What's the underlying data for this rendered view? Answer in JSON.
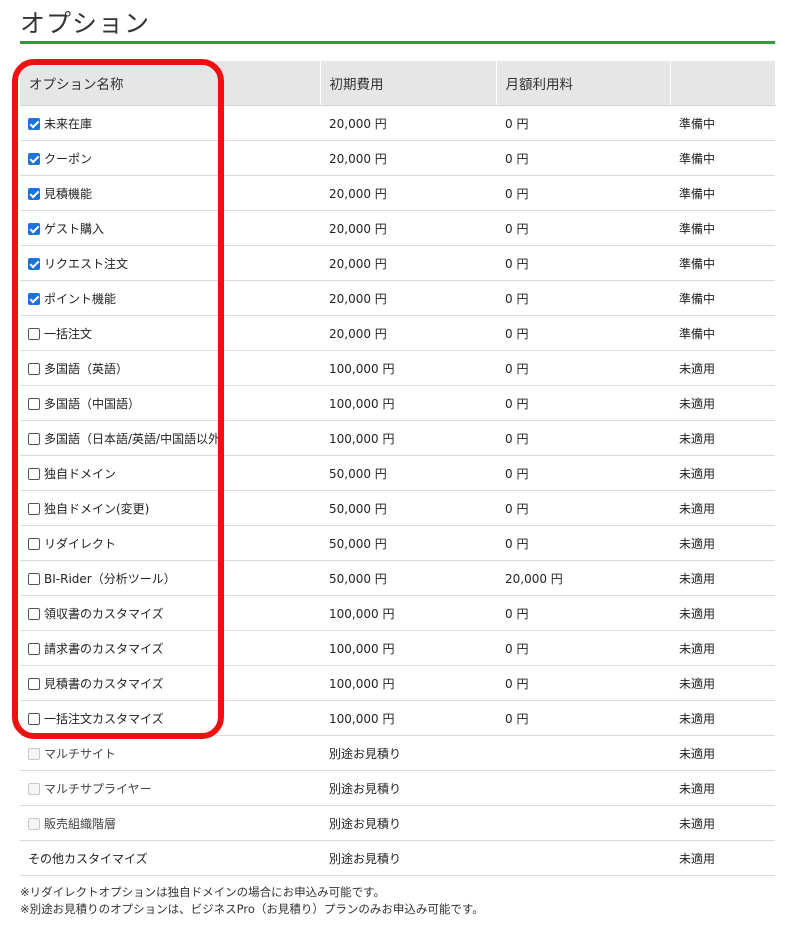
{
  "page": {
    "title": "オプション"
  },
  "colors": {
    "accent_rule": "#2e9a3c",
    "checkbox_checked": "#1a73d9",
    "highlight": "#ee1111"
  },
  "table": {
    "headers": [
      "オプション名称",
      "初期費用",
      "月額利用料",
      ""
    ],
    "rows": [
      {
        "name": "未来在庫",
        "initial": "20,000 円",
        "monthly": "0 円",
        "status": "準備中",
        "checkbox": "checked"
      },
      {
        "name": "クーポン",
        "initial": "20,000 円",
        "monthly": "0 円",
        "status": "準備中",
        "checkbox": "checked"
      },
      {
        "name": "見積機能",
        "initial": "20,000 円",
        "monthly": "0 円",
        "status": "準備中",
        "checkbox": "checked"
      },
      {
        "name": "ゲスト購入",
        "initial": "20,000 円",
        "monthly": "0 円",
        "status": "準備中",
        "checkbox": "checked"
      },
      {
        "name": "リクエスト注文",
        "initial": "20,000 円",
        "monthly": "0 円",
        "status": "準備中",
        "checkbox": "checked"
      },
      {
        "name": "ポイント機能",
        "initial": "20,000 円",
        "monthly": "0 円",
        "status": "準備中",
        "checkbox": "checked"
      },
      {
        "name": "一括注文",
        "initial": "20,000 円",
        "monthly": "0 円",
        "status": "準備中",
        "checkbox": "unchecked"
      },
      {
        "name": "多国語（英語）",
        "initial": "100,000 円",
        "monthly": "0 円",
        "status": "未適用",
        "checkbox": "unchecked"
      },
      {
        "name": "多国語（中国語）",
        "initial": "100,000 円",
        "monthly": "0 円",
        "status": "未適用",
        "checkbox": "unchecked"
      },
      {
        "name": "多国語（日本語/英語/中国語以外",
        "initial": "100,000 円",
        "monthly": "0 円",
        "status": "未適用",
        "checkbox": "unchecked"
      },
      {
        "name": "独自ドメイン",
        "initial": "50,000 円",
        "monthly": "0 円",
        "status": "未適用",
        "checkbox": "unchecked"
      },
      {
        "name": "独自ドメイン(変更)",
        "initial": "50,000 円",
        "monthly": "0 円",
        "status": "未適用",
        "checkbox": "unchecked"
      },
      {
        "name": "リダイレクト",
        "initial": "50,000 円",
        "monthly": "0 円",
        "status": "未適用",
        "checkbox": "unchecked"
      },
      {
        "name": "BI-Rider（分析ツール）",
        "initial": "50,000 円",
        "monthly": "20,000 円",
        "status": "未適用",
        "checkbox": "unchecked"
      },
      {
        "name": "領収書のカスタマイズ",
        "initial": "100,000 円",
        "monthly": "0 円",
        "status": "未適用",
        "checkbox": "unchecked"
      },
      {
        "name": "請求書のカスタマイズ",
        "initial": "100,000 円",
        "monthly": "0 円",
        "status": "未適用",
        "checkbox": "unchecked"
      },
      {
        "name": "見積書のカスタマイズ",
        "initial": "100,000 円",
        "monthly": "0 円",
        "status": "未適用",
        "checkbox": "unchecked"
      },
      {
        "name": "一括注文カスタマイズ",
        "initial": "100,000 円",
        "monthly": "0 円",
        "status": "未適用",
        "checkbox": "unchecked"
      },
      {
        "name": "マルチサイト",
        "initial": "別途お見積り",
        "monthly": "",
        "status": "未適用",
        "checkbox": "disabled"
      },
      {
        "name": "マルチサプライヤー",
        "initial": "別途お見積り",
        "monthly": "",
        "status": "未適用",
        "checkbox": "disabled"
      },
      {
        "name": "販売組織階層",
        "initial": "別途お見積り",
        "monthly": "",
        "status": "未適用",
        "checkbox": "disabled"
      },
      {
        "name": "その他カスタイマイズ",
        "initial": "別途お見積り",
        "monthly": "",
        "status": "未適用",
        "checkbox": "none"
      }
    ]
  },
  "notes": [
    "※リダイレクトオプションは独自ドメインの場合にお申込み可能です。",
    "※別途お見積りのオプションは、ビジネスPro（お見積り）プランのみお申込み可能です。"
  ]
}
